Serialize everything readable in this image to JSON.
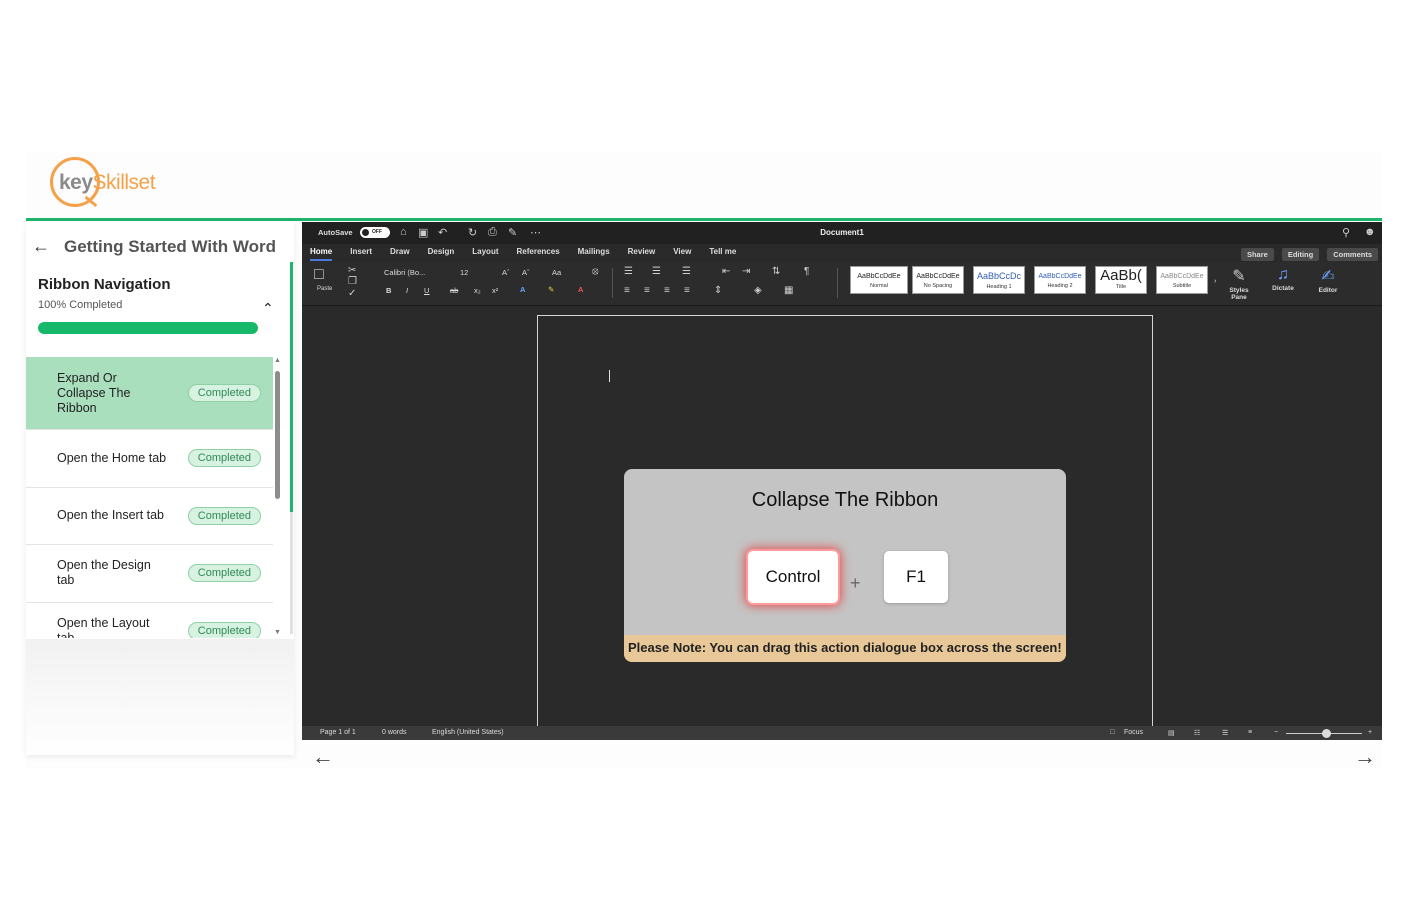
{
  "brand": {
    "logo_key": "key",
    "logo_skillset": "Skillset"
  },
  "sidebar": {
    "course_title": "Getting Started With Word",
    "module_title": "Ribbon Navigation",
    "module_progress_text": "100% Completed",
    "progress": 1.0,
    "lessons": [
      {
        "label": "Expand Or Collapse The Ribbon",
        "status": "Completed"
      },
      {
        "label": "Open the Home tab",
        "status": "Completed"
      },
      {
        "label": "Open the Insert tab",
        "status": "Completed"
      },
      {
        "label": "Open the Design tab",
        "status": "Completed"
      },
      {
        "label": "Open the Layout tab",
        "status": "Completed"
      }
    ]
  },
  "word": {
    "autosave": "AutoSave",
    "autosave_state": "OFF",
    "doc_title": "Document1",
    "tabs": [
      "Home",
      "Insert",
      "Draw",
      "Design",
      "Layout",
      "References",
      "Mailings",
      "Review",
      "View",
      "Tell me"
    ],
    "share": "Share",
    "editing": "Editing",
    "comments": "Comments",
    "paste": "Paste",
    "font_name": "Calibri (Bo...",
    "font_size": "12",
    "styles": [
      {
        "preview": "AaBbCcDdEe",
        "name": "Normal"
      },
      {
        "preview": "AaBbCcDdEe",
        "name": "No Spacing"
      },
      {
        "preview": "AaBbCcDc",
        "name": "Heading 1"
      },
      {
        "preview": "AaBbCcDdEe",
        "name": "Heading 2"
      },
      {
        "preview": "AaBb(",
        "name": "Title"
      },
      {
        "preview": "AaBbCcDdEe",
        "name": "Subtitle"
      }
    ],
    "styles_pane": "Styles Pane",
    "dictate": "Dictate",
    "editor": "Editor",
    "status": {
      "page": "Page 1 of 1",
      "words": "0 words",
      "language": "English (United States)",
      "focus": "Focus"
    }
  },
  "dialog": {
    "title": "Collapse The Ribbon",
    "key1": "Control",
    "plus": "+",
    "key2": "F1",
    "note": "Please Note: You can drag this action dialogue box across the screen!"
  },
  "colors": {
    "brand_green": "#1db56c",
    "brand_orange": "#f5a14a",
    "active_lesson": "#a9dfbd",
    "highlight_red": "#e05050"
  }
}
